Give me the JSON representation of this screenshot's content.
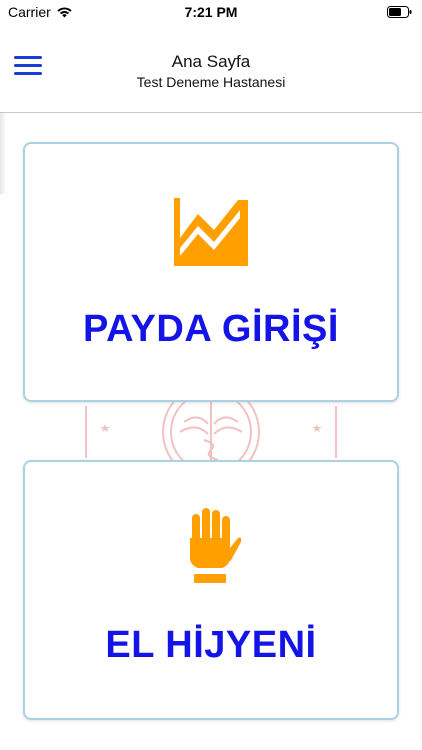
{
  "status_bar": {
    "carrier": "Carrier",
    "time": "7:21 PM",
    "wifi_icon": "wifi-icon",
    "battery_icon": "battery-icon"
  },
  "nav": {
    "title": "Ana Sayfa",
    "subtitle": "Test Deneme Hastanesi",
    "menu_icon": "hamburger-menu-icon"
  },
  "cards": [
    {
      "label": "PAYDA GİRİŞİ",
      "icon": "area-chart-icon"
    },
    {
      "label": "EL HİJYENİ",
      "icon": "hand-icon"
    }
  ],
  "watermark": {
    "icon": "ministry-seal-icon"
  },
  "colors": {
    "accent_blue": "#1414e6",
    "menu_blue": "#1a3fd6",
    "icon_orange": "#ffa000",
    "card_border": "#a9d3e3",
    "seal_red": "#d9534f"
  }
}
